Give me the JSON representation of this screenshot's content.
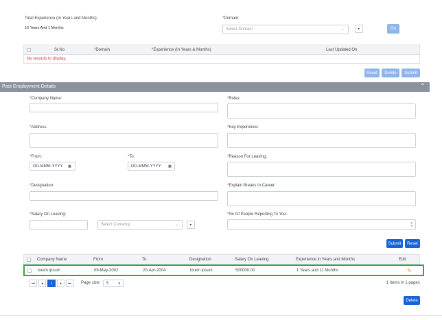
{
  "experience": {
    "total_label": "Total Experience (In Years and Months):",
    "total_value": "16 Years And 1 Months",
    "domain_label": "Domain:",
    "domain_placeholder": "Select Domain",
    "arrow_glyph": "▸",
    "go_label": "Go"
  },
  "domain_grid": {
    "headers": [
      "Sr.No",
      "Domain",
      "Experience (In Years & Months)",
      "Last Updated On"
    ],
    "empty_message": "No records to display."
  },
  "domain_actions": {
    "reset": "Reset",
    "delete": "Delete",
    "submit": "Submit"
  },
  "past_employment": {
    "section_title": "Past Employment Details",
    "company_name_label": "Company Name:",
    "roles_label": "Roles:",
    "address_label": "Address:",
    "key_experience_label": "Key Experience:",
    "from_label": "From:",
    "from_placeholder": "DD-MMM-YYYY",
    "to_label": "To:",
    "to_placeholder": "DD-MMM-YYYY",
    "reason_label": "Reason For Leaving:",
    "designation_label": "Designation:",
    "breaks_label": "Explain Breaks In Career:",
    "salary_label": "Salary On Leaving:",
    "currency_placeholder": "Select Currency",
    "reporting_label": "No Of People Reporting To You:",
    "submit": "Submit",
    "reset": "Reset"
  },
  "employment_grid": {
    "headers": [
      "Company Name",
      "From",
      "To",
      "Designation",
      "Salary On Leaving",
      "Experience in Years and Months",
      "Edit"
    ],
    "rows": [
      {
        "company": "lorem ipsum",
        "from": "09-May-2002",
        "to": "20-Apr-2004",
        "designation": "lorem ipsum",
        "salary": "500000.00",
        "experience": "1 Years and 11 Months"
      }
    ]
  },
  "pager": {
    "first": "⏮",
    "prev": "◂",
    "current_page": "1",
    "next": "▸",
    "last": "⏭",
    "page_size_label": "Page size:",
    "page_size_value": "5",
    "summary": "1 items in 1 pages"
  },
  "bottom_actions": {
    "delete": "Delete"
  },
  "colors": {
    "accent": "#1565d8",
    "accent_light": "#8fb6ec",
    "section_bar": "#8a929e",
    "required": "#d9363e",
    "row_highlight": "#2eaa3c"
  }
}
